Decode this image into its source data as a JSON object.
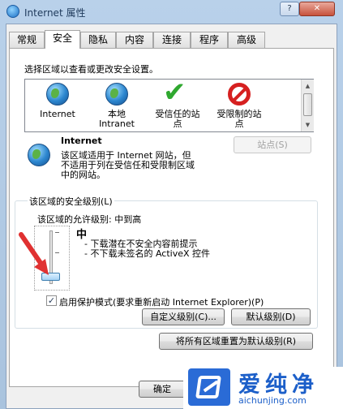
{
  "window": {
    "title": "Internet 属性",
    "help_glyph": "?",
    "close_glyph": "✕"
  },
  "tabs": [
    {
      "label": "常规"
    },
    {
      "label": "安全"
    },
    {
      "label": "隐私"
    },
    {
      "label": "内容"
    },
    {
      "label": "连接"
    },
    {
      "label": "程序"
    },
    {
      "label": "高级"
    }
  ],
  "security": {
    "instruction": "选择区域以查看或更改安全设置。",
    "zones": [
      {
        "line1": "Internet",
        "line2": "",
        "icon": "globe-icon"
      },
      {
        "line1": "本地",
        "line2": "Intranet",
        "icon": "intranet-icon"
      },
      {
        "line1": "受信任的站",
        "line2": "点",
        "icon": "trusted-check-icon"
      },
      {
        "line1": "受限制的站",
        "line2": "点",
        "icon": "restricted-icon"
      }
    ],
    "selected_zone": {
      "name": "Internet",
      "desc1": "该区域适用于 Internet 网站，但",
      "desc2": "不适用于列在受信任和受限制区域",
      "desc3": "中的网站。"
    },
    "sites_button": "站点(S)",
    "level_group_label": "该区域的安全级别(L)",
    "allowed_levels": "该区域的允许级别: 中到高",
    "level_name": "中",
    "level_desc1": "- 下载潜在不安全内容前提示",
    "level_desc2": "- 不下载未签名的 ActiveX 控件",
    "protected_mode_label": "启用保护模式(要求重新启动 Internet Explorer)(P)",
    "protected_mode_checked": "✓",
    "custom_level_button": "自定义级别(C)...",
    "default_level_button": "默认级别(D)",
    "reset_all_button": "将所有区域重置为默认级别(R)"
  },
  "footer": {
    "ok_button": "确定"
  },
  "watermark": {
    "brand": "爱纯净",
    "url": "aichunjing.com"
  }
}
